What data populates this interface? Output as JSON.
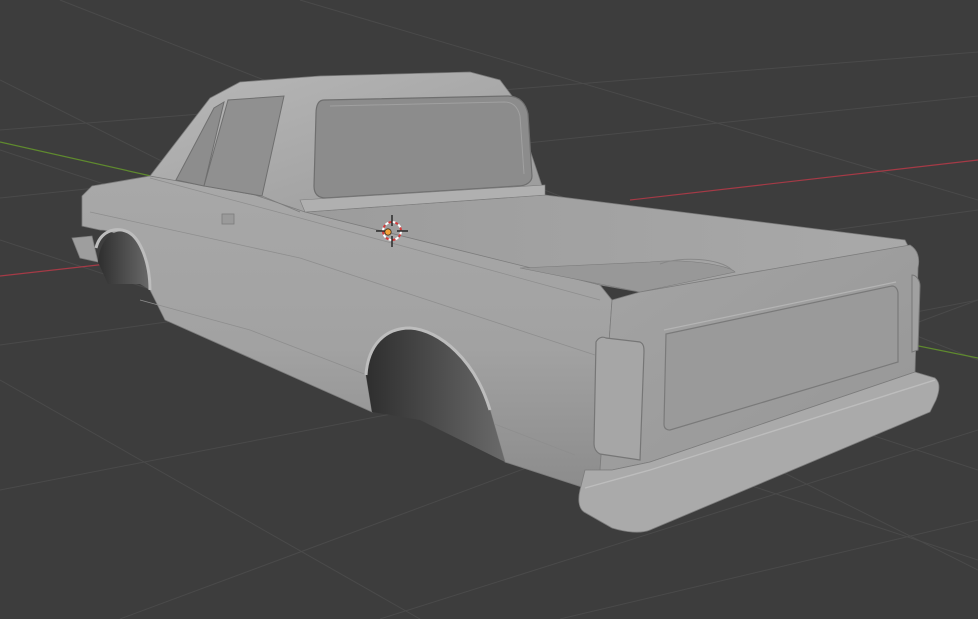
{
  "app": {
    "name": "3D viewport",
    "view": "perspective",
    "shading": "solid"
  },
  "viewport": {
    "background_color": "#3d3d3d",
    "grid_color": "#4a4a4a",
    "x_axis_color": "#a53a46",
    "y_axis_color": "#5f8a2e",
    "grid_visible": true
  },
  "scene": {
    "object": "pickup-truck-body",
    "material_color": "#a9a9a9",
    "cursor": "3d-cursor-icon"
  }
}
